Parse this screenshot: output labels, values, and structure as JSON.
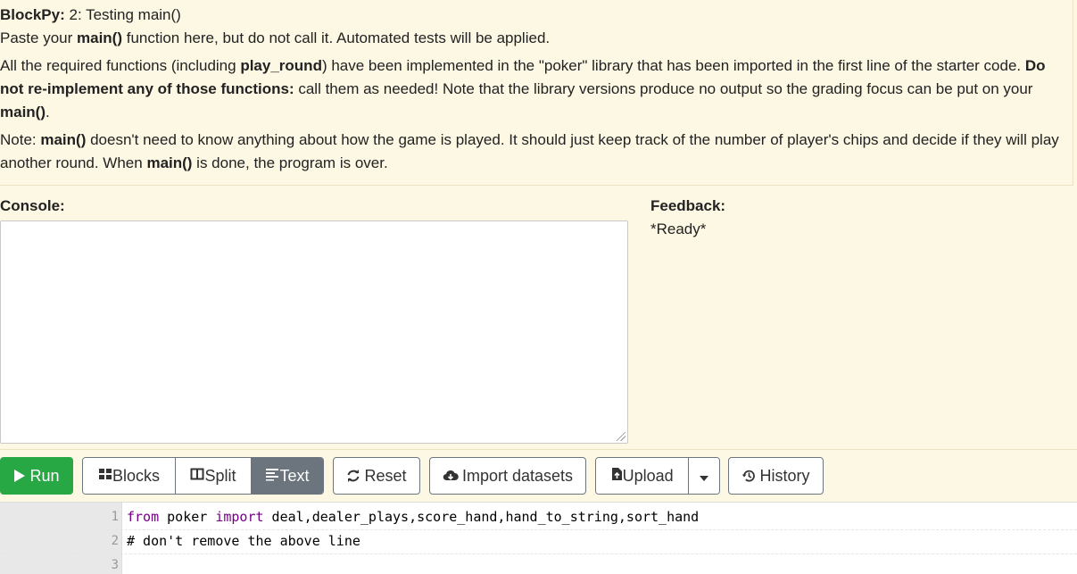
{
  "header": {
    "app_name": "BlockPy:",
    "assignment_title": "2: Testing main()"
  },
  "instructions": {
    "p1": {
      "before": "Paste your ",
      "bold": "main()",
      "after": " function here, but do not call it. Automated tests will be applied."
    },
    "p2": {
      "before": "All the required functions (including ",
      "bold1": "play_round",
      "middle": ") have been implemented in the \"poker\" library that has been imported in the first line of the starter code. ",
      "bold2": "Do not re-implement any of those functions:",
      "after": " call them as needed! Note that the library versions produce no output so the grading focus can be put on your ",
      "bold3": "main()",
      "end": "."
    },
    "p3": {
      "before": "Note: ",
      "bold1": "main()",
      "middle": " doesn't need to know anything about how the game is played. It should just keep track of the number of player's chips and decide if they will play another round. When ",
      "bold2": "main()",
      "after": " is done, the program is over."
    }
  },
  "console": {
    "label": "Console:",
    "content": ""
  },
  "feedback": {
    "label": "Feedback:",
    "status": "*Ready*"
  },
  "toolbar": {
    "run_label": "Run",
    "blocks_label": "Blocks",
    "split_label": "Split",
    "text_label": "Text",
    "active_mode": "Text",
    "reset_label": "Reset",
    "import_label": "Import datasets",
    "upload_label": "Upload",
    "history_label": "History"
  },
  "colors": {
    "run": "#28a745",
    "active_mode": "#6c757d",
    "background": "#fdf8e4",
    "keyword": "#770088",
    "comment": "#aa5500"
  },
  "icons": {
    "run": "play-icon",
    "blocks": "grid-icon",
    "split": "columns-icon",
    "text": "align-left-icon",
    "reset": "refresh-icon",
    "import": "cloud-download-icon",
    "upload": "file-upload-icon",
    "upload_menu": "caret-down-icon",
    "history": "history-icon"
  },
  "editor": {
    "lines": [
      {
        "num": "1",
        "kw1": "from",
        "t1": " poker ",
        "kw2": "import",
        "t2": " deal,dealer_plays,score_hand,hand_to_string,sort_hand"
      },
      {
        "num": "2",
        "comment": "# don't remove the above line"
      },
      {
        "num": "3",
        "text": ""
      }
    ]
  }
}
